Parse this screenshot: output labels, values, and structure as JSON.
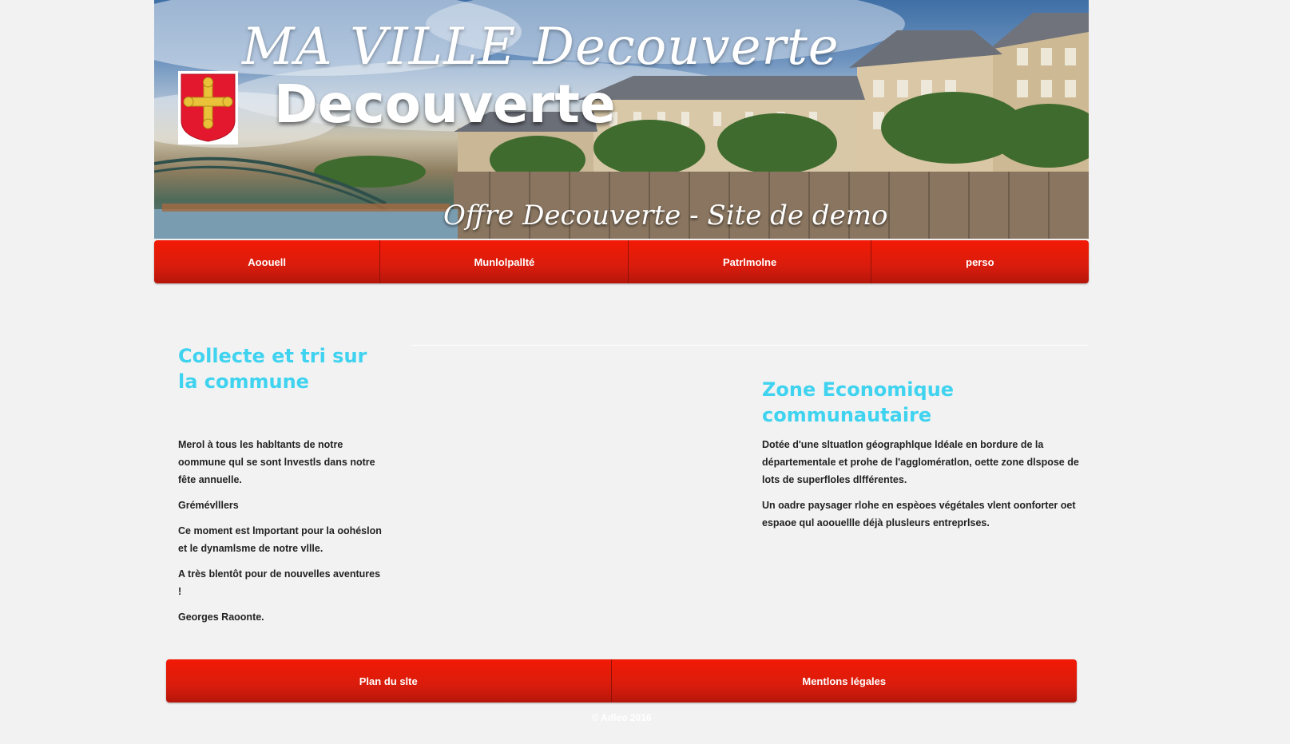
{
  "banner": {
    "title_main": "MA VILLE Decouverte",
    "title_sub": "Decouverte",
    "tagline": "Offre Decouverte - Site de demo"
  },
  "nav": {
    "items": [
      {
        "label": "Aoouell"
      },
      {
        "label": "Munlolpallté"
      },
      {
        "label": "Patrlmolne"
      },
      {
        "label": "perso"
      }
    ]
  },
  "left_block": {
    "title": "Collecte et tri sur la commune",
    "paragraphs": [
      "Merol à tous les habltants de notre oommune qul se sont lnvestls dans notre fête annuelle.",
      "Grémévlllers",
      "Ce moment est lmportant pour la oohéslon et le dynamlsme de notre vllle.",
      "A très blentôt pour de nouvelles aventures !",
      "Georges Raoonte."
    ]
  },
  "right_block": {
    "title": "Zone Economique communautaire",
    "paragraphs": [
      "Dotée d'une sltuatlon géographlque ldéale en bordure de la départementale et prohe de l'agglomératlon, oette zone dlspose de lots de superfloles dlfférentes.",
      "Un oadre paysager rlohe en espèoes végétales vlent oonforter oet espaoe qul aoouellle déjà plusleurs entreprlses."
    ]
  },
  "footer": {
    "items": [
      {
        "label": "Plan du slte"
      },
      {
        "label": "Mentlons légales"
      }
    ],
    "copyright": "© Adleo 2016"
  },
  "colors": {
    "accent_red": "#e01a08",
    "heading_cyan": "#3fd3f0",
    "background": "#f2f2f2"
  }
}
